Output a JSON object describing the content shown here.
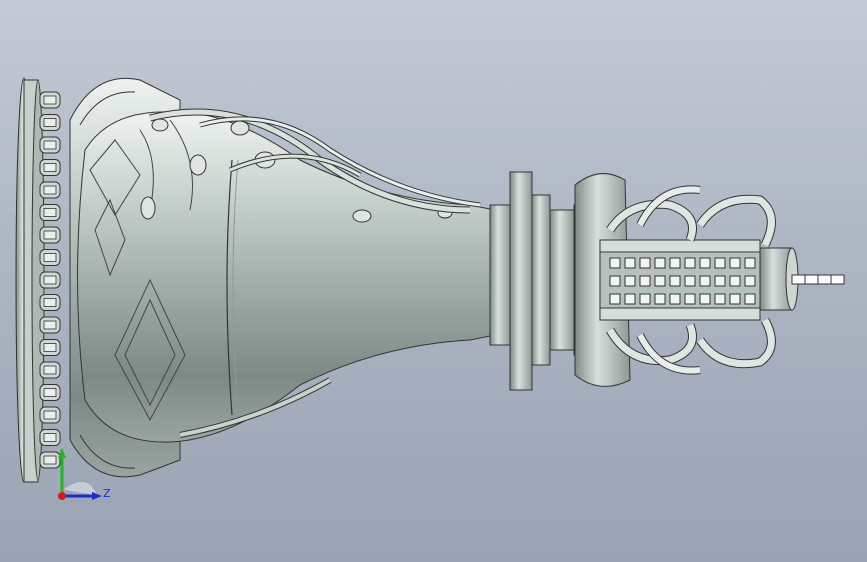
{
  "viewport": {
    "background_top": "#c4cad6",
    "background_bottom": "#9aa3b3",
    "model_color": "#b9c4bf"
  },
  "triad": {
    "z_label": "Z",
    "y_color": "#1fb81f",
    "z_color": "#1a2ccf",
    "origin_color": "#d11b1b"
  }
}
